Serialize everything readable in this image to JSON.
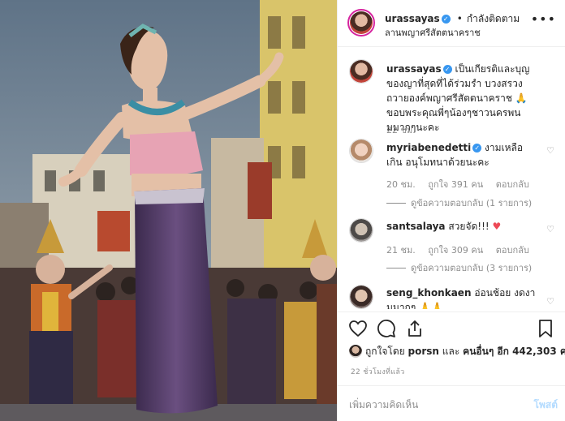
{
  "post": {
    "username": "urassayas",
    "follow_state": "กำลังติดตาม",
    "location": "ลานพญาศรีสัตตนาคราช",
    "caption": "เป็นเกียรติและบุญของญาที่สุดที่ได้ร่วมรำ บวงสรวงถวายองค์พญาศรีสัตตนาคราช 🙏 ขอบพระคุณพี่ๆน้องๆชาวนครพนมมากๆนะคะ",
    "caption_time": "22 ชม.",
    "likes_prefix": "ถูกใจโดย",
    "likes_user": "porsn",
    "likes_middle": "และ",
    "likes_others": "คนอื่นๆ อีก 442,303 คน",
    "timestamp": "22 ชั่วโมงที่แล้ว",
    "add_comment_placeholder": "เพิ่มความคิดเห็น",
    "post_label": "โพสต์"
  },
  "comments": [
    {
      "username": "myriabenedetti",
      "text": "งามเหลือเกิน อนุโมทนาด้วยนะคะ",
      "time": "20 ชม.",
      "likes": "ถูกใจ 391 คน",
      "reply_label": "ตอบกลับ",
      "view_replies": "ดูข้อความตอบกลับ (1 รายการ)"
    },
    {
      "username": "santsalaya",
      "text": "สวยจัด!!!",
      "time": "21 ชม.",
      "likes": "ถูกใจ 309 คน",
      "reply_label": "ตอบกลับ",
      "view_replies": "ดูข้อความตอบกลับ (3 รายการ)"
    },
    {
      "username": "seng_khonkaen",
      "text": "อ่อนช้อย งดงามมากๆ 🙏🙏"
    }
  ],
  "icons": {
    "more": "more-icon",
    "verified": "verified-badge-icon",
    "heart": "heart-icon",
    "comment": "comment-icon",
    "share": "share-icon",
    "bookmark": "bookmark-icon"
  },
  "colors": {
    "accent_blue": "#3897f0",
    "like_red": "#ed4956",
    "muted": "#8e8e8e",
    "post_disabled": "#b3dbff"
  }
}
